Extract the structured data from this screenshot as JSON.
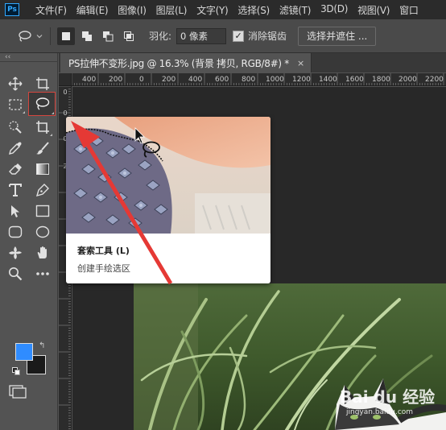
{
  "app": {
    "logo_text": "Ps"
  },
  "menu": {
    "items": [
      "文件(F)",
      "编辑(E)",
      "图像(I)",
      "图层(L)",
      "文字(Y)",
      "选择(S)",
      "滤镜(T)",
      "3D(D)",
      "视图(V)",
      "窗口"
    ]
  },
  "options": {
    "feather_label": "羽化:",
    "feather_value": "0 像素",
    "antialias_label": "消除锯齿",
    "antialias_checked": true,
    "select_mask_label": "选择并遮住 ..."
  },
  "toolbox": {
    "collapse_glyph": "‹‹",
    "selected_tool": "lasso",
    "foreground_color": "#2f8cff",
    "background_color": "#1a1a1a",
    "tools": [
      "move-tool",
      "artboard-tool",
      "marquee-tool",
      "lasso-tool",
      "quick-select-tool",
      "crop-tool",
      "eyedropper-tool",
      "brush-tool",
      "eraser-tool",
      "gradient-tool",
      "type-tool",
      "pen-tool",
      "path-select-tool",
      "rectangle-tool",
      "rounded-rect-tool",
      "ellipse-tool",
      "custom-shape-tool",
      "hand-tool",
      "zoom-tool",
      "more-tools",
      "quick-mask-tool"
    ]
  },
  "document": {
    "tab_title": "PS拉伸不变形.jpg @ 16.3% (背景 拷贝, RGB/8#) *",
    "close_glyph": "×"
  },
  "rulers": {
    "horizontal": [
      "400",
      "200",
      "0",
      "200",
      "400",
      "600",
      "800",
      "1000",
      "1200",
      "1400",
      "1600",
      "1800",
      "2000",
      "2200"
    ],
    "vertical": [
      "0",
      "0",
      "0",
      "2"
    ]
  },
  "tooltip": {
    "title": "套索工具 (L)",
    "description": "创建手绘选区"
  },
  "watermark": {
    "text": "Bai du 经验",
    "subtext": "jingyan.baidu.com"
  },
  "accent_colors": {
    "highlight": "#d4463e",
    "arrow": "#e53935"
  }
}
